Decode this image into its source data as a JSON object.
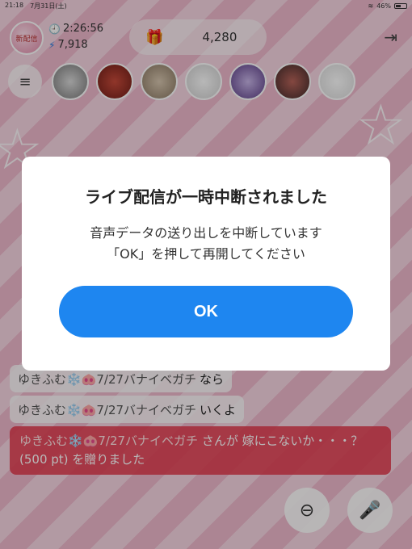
{
  "status_bar": {
    "time": "21:18",
    "date": "7月31日(土)",
    "battery": "46%"
  },
  "header": {
    "host_avatar_text": "新配信",
    "elapsed_time": "2:26:56",
    "points": "7,918",
    "gift_count": "4,280"
  },
  "chat": {
    "messages": [
      {
        "user": "ゆきふむ❄️🐽7/27バナイベガチ",
        "text": "なら"
      },
      {
        "user": "ゆきふむ❄️🐽7/27バナイベガチ",
        "text": "いくよ"
      }
    ],
    "gift_message": {
      "user": "ゆきふむ❄️🐽7/27バナイベガチ",
      "text": "さんが 嫁にこないか・・・？ (500 pt) を贈りました"
    }
  },
  "modal": {
    "title": "ライブ配信が一時中断されました",
    "body_line1": "音声データの送り出しを中断しています",
    "body_line2": "「OK」を押して再開してください",
    "ok_label": "OK"
  },
  "colors": {
    "accent": "#1e86f0",
    "gift_banner": "#e43c50"
  }
}
